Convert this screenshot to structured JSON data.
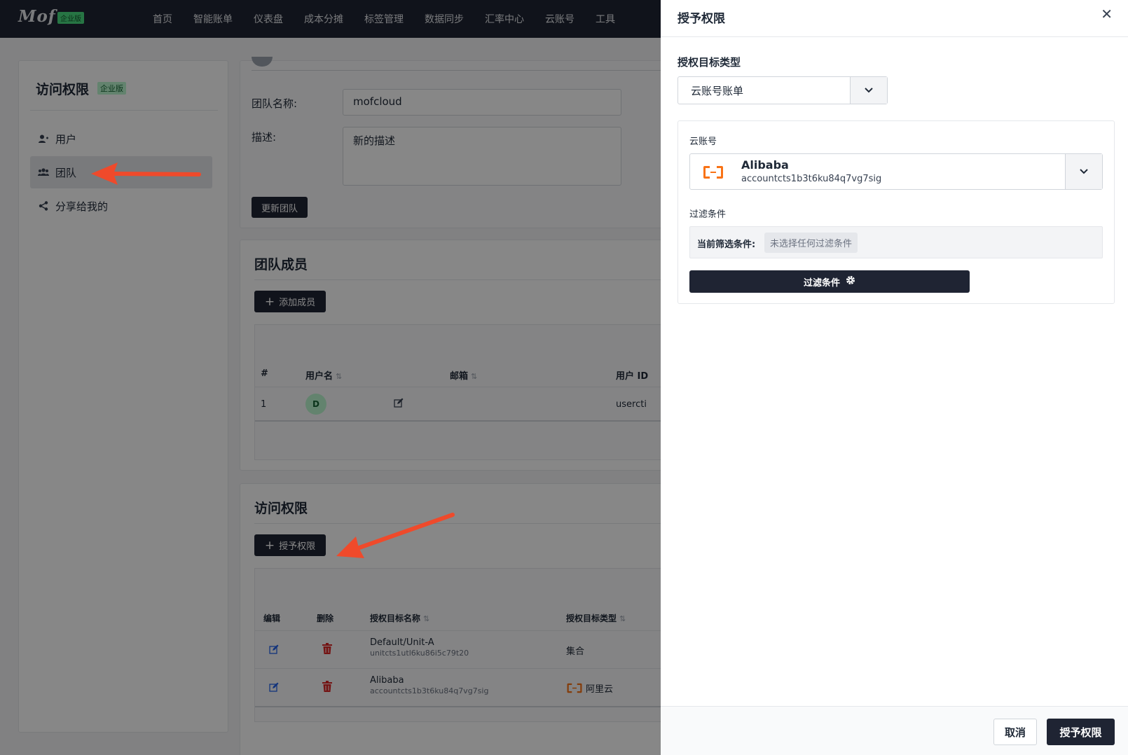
{
  "nav": {
    "logo": "Mof",
    "logo_badge": "企业版",
    "items": [
      "首页",
      "智能账单",
      "仪表盘",
      "成本分摊",
      "标签管理",
      "数据同步",
      "汇率中心",
      "云账号",
      "工具"
    ]
  },
  "sidebar": {
    "title": "访问权限",
    "badge": "企业版",
    "items": [
      {
        "label": "用户",
        "icon": "user-icon"
      },
      {
        "label": "团队",
        "icon": "users-icon"
      },
      {
        "label": "分享给我的",
        "icon": "share-icon"
      }
    ]
  },
  "team_form": {
    "name_label": "团队名称:",
    "name_value": "mofcloud",
    "desc_label": "描述:",
    "desc_value": "新的描述",
    "update_button": "更新团队"
  },
  "members": {
    "title": "团队成员",
    "add_button": "添加成员",
    "columns": [
      "#",
      "用户名",
      "邮箱",
      "用户 ID"
    ],
    "rows": [
      {
        "index": "1",
        "avatar": "D",
        "user_id": "usercti"
      }
    ]
  },
  "access": {
    "title": "访问权限",
    "grant_button": "授予权限",
    "columns": [
      "编辑",
      "删除",
      "授权目标名称",
      "授权目标类型"
    ],
    "rows": [
      {
        "name": "Default/Unit-A",
        "id": "unitcts1utl6ku86i5c79t20",
        "type": "集合"
      },
      {
        "name": "Alibaba",
        "id": "accountcts1b3t6ku84q7vg7sig",
        "type": "阿里云"
      }
    ]
  },
  "drawer": {
    "title": "授予权限",
    "target_type_label": "授权目标类型",
    "target_type_value": "云账号账单",
    "account_label": "云账号",
    "account_name": "Alibaba",
    "account_id": "accountcts1b3t6ku84q7vg7sig",
    "filter_label": "过滤条件",
    "current_filter_label": "当前筛选条件:",
    "current_filter_value": "未选择任何过滤条件",
    "filter_button": "过滤条件",
    "cancel_button": "取消",
    "grant_button": "授予权限"
  },
  "colors": {
    "nav_bg": "#1f2433",
    "accent_dark": "#1f2433",
    "alibaba_orange": "#f97316",
    "arrow_red": "#ef4a2b",
    "delete_red": "#dc2626",
    "edit_blue": "#2563eb"
  }
}
